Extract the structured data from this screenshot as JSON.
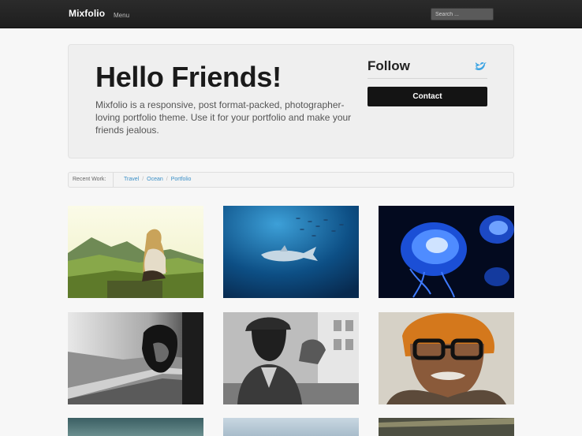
{
  "nav": {
    "brand": "Mixfolio",
    "menu_label": "Menu",
    "search_placeholder": "Search ..."
  },
  "hero": {
    "title": "Hello Friends!",
    "description": "Mixfolio is a responsive, post format-packed, photographer-loving portfolio theme. Use it for your portfolio and make your friends jealous.",
    "follow_title": "Follow",
    "contact_label": "Contact",
    "twitter_color": "#3aa3e3"
  },
  "recent_work": {
    "label": "Recent Work:",
    "categories": [
      "Travel",
      "Ocean",
      "Portfolio"
    ]
  },
  "gallery": {
    "items": [
      {
        "subject": "woman-sitting-on-mountain"
      },
      {
        "subject": "shark-underwater"
      },
      {
        "subject": "glowing-jellyfish"
      },
      {
        "subject": "man-looking-from-train"
      },
      {
        "subject": "man-in-cap"
      },
      {
        "subject": "old-man-with-turban"
      },
      {
        "subject": "partial-photo"
      },
      {
        "subject": "partial-photo"
      },
      {
        "subject": "partial-photo"
      }
    ]
  }
}
